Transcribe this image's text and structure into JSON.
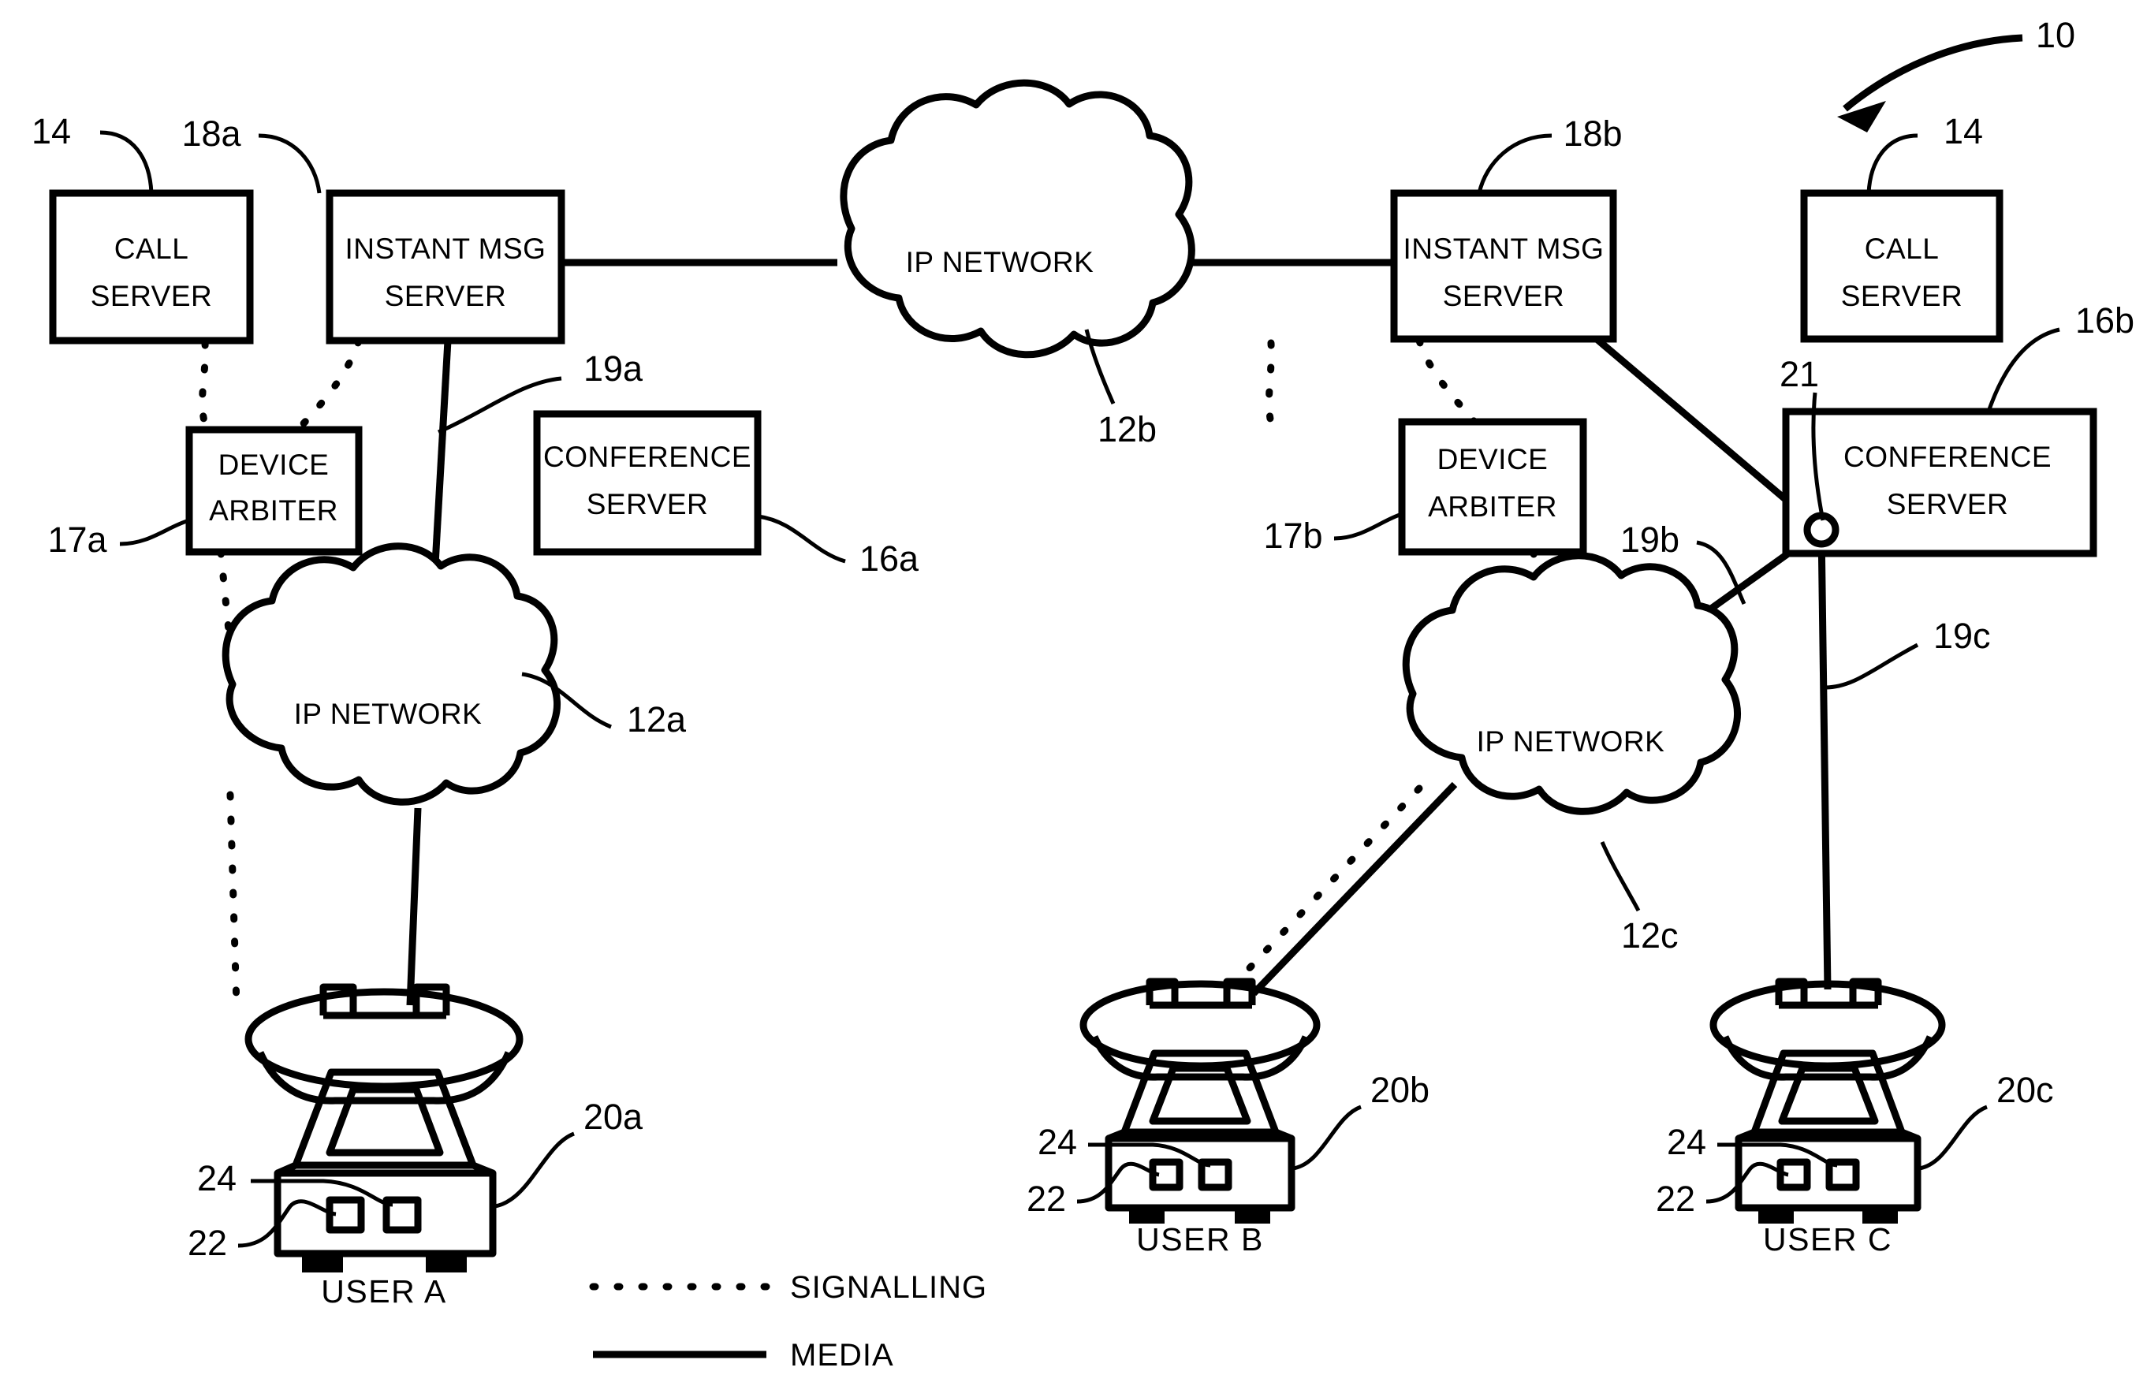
{
  "figure": {
    "reference": "10"
  },
  "nodes": {
    "call_server_left": {
      "line1": "CALL",
      "line2": "SERVER",
      "ref": "14"
    },
    "im_server_left": {
      "line1": "INSTANT MSG",
      "line2": "SERVER",
      "ref": "18a"
    },
    "ip_network_center": {
      "label": "IP NETWORK",
      "ref": "12b"
    },
    "im_server_right": {
      "line1": "INSTANT MSG",
      "line2": "SERVER",
      "ref": "18b"
    },
    "call_server_right": {
      "line1": "CALL",
      "line2": "SERVER",
      "ref": "14"
    },
    "device_arbiter_left": {
      "line1": "DEVICE",
      "line2": "ARBITER",
      "ref": "17a"
    },
    "conference_server_left": {
      "line1": "CONFERENCE",
      "line2": "SERVER",
      "ref": "16a"
    },
    "device_arbiter_right": {
      "line1": "DEVICE",
      "line2": "ARBITER",
      "ref": "17b"
    },
    "conference_server_right": {
      "line1": "CONFERENCE",
      "line2": "SERVER",
      "ref": "16b"
    },
    "ip_network_left": {
      "label": "IP NETWORK",
      "ref": "12a"
    },
    "ip_network_right": {
      "label": "IP NETWORK",
      "ref": "12c"
    },
    "junction": {
      "ref": "21"
    }
  },
  "links": {
    "media_19a": "19a",
    "media_19b": "19b",
    "media_19c": "19c"
  },
  "endpoints": [
    {
      "name": "USER A",
      "device_ref": "20a",
      "button_ref": "22",
      "indicator_ref": "24"
    },
    {
      "name": "USER B",
      "device_ref": "20b",
      "button_ref": "22",
      "indicator_ref": "24"
    },
    {
      "name": "USER C",
      "device_ref": "20c",
      "button_ref": "22",
      "indicator_ref": "24"
    }
  ],
  "legend": {
    "signalling": "SIGNALLING",
    "media": "MEDIA"
  },
  "colors": {
    "ink": "#000000",
    "paper": "#ffffff"
  }
}
